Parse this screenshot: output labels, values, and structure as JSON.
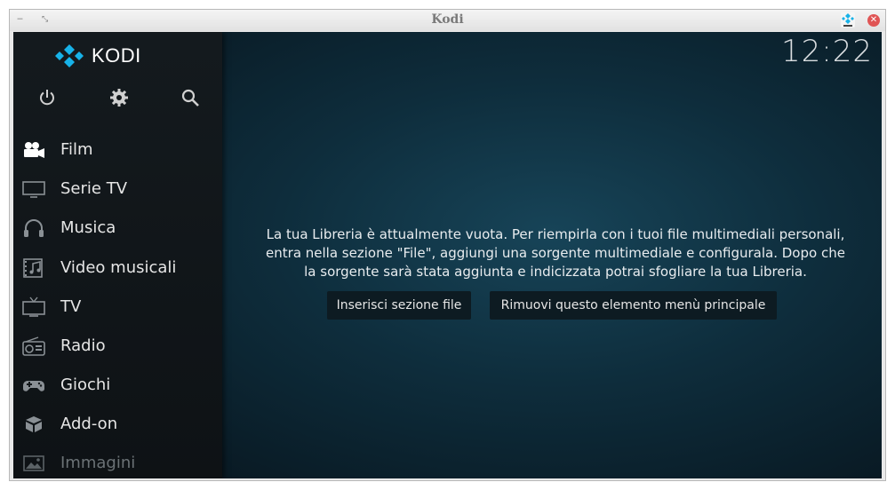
{
  "window": {
    "title": "Kodi",
    "close_glyph": "✕"
  },
  "app": {
    "brand": "KODI",
    "clock": "12:22",
    "top_icons": [
      "power-icon",
      "gear-icon",
      "search-icon"
    ],
    "menu": [
      {
        "label": "Film",
        "icon": "movie-camera-icon"
      },
      {
        "label": "Serie TV",
        "icon": "monitor-icon"
      },
      {
        "label": "Musica",
        "icon": "headphones-icon"
      },
      {
        "label": "Video musicali",
        "icon": "music-video-icon"
      },
      {
        "label": "TV",
        "icon": "tv-icon"
      },
      {
        "label": "Radio",
        "icon": "radio-icon"
      },
      {
        "label": "Giochi",
        "icon": "gamepad-icon"
      },
      {
        "label": "Add-on",
        "icon": "addon-box-icon"
      },
      {
        "label": "Immagini",
        "icon": "picture-icon"
      }
    ],
    "message": {
      "line1": "La tua Libreria è attualmente vuota. Per riempirla con i tuoi file multimediali personali,",
      "line2": "entra nella sezione \"File\", aggiungi una sorgente multimediale e configurala. Dopo che",
      "line3": "la sorgente sarà stata aggiunta e indicizzata potrai sfogliare la tua Libreria."
    },
    "buttons": {
      "enter_files": "Inserisci sezione file",
      "remove_item": "Rimuovi questo elemento menù principale"
    },
    "colors": {
      "accent": "#17b2e8",
      "sidebar": "#12171a",
      "background": "#0e2d3c"
    }
  }
}
